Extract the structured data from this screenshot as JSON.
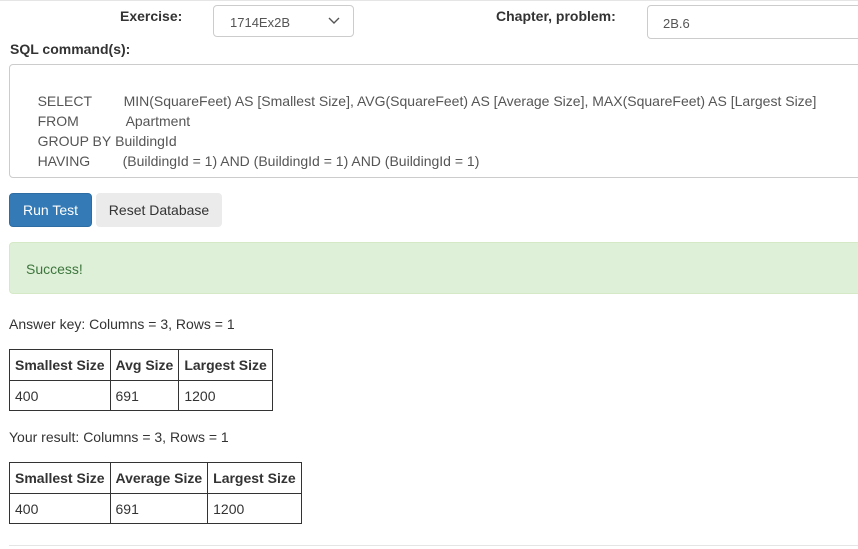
{
  "form": {
    "exercise_label": "Exercise:",
    "exercise_value": "1714Ex2B",
    "chapter_label": "Chapter, problem:",
    "chapter_value": "2B.6",
    "sql_label": "SQL command(s):"
  },
  "sql": {
    "lines": [
      {
        "keyword": "SELECT",
        "text": "MIN(SquareFeet) AS [Smallest Size], AVG(SquareFeet) AS [Average Size], MAX(SquareFeet) AS [Largest Size]"
      },
      {
        "keyword": "FROM",
        "text": "Apartment"
      },
      {
        "keyword": "GROUP BY",
        "text": "BuildingId"
      },
      {
        "keyword": "HAVING",
        "text": "(BuildingId = 1) AND (BuildingId = 1) AND (BuildingId = 1)"
      }
    ]
  },
  "buttons": {
    "run_test": "Run Test",
    "reset_database": "Reset Database"
  },
  "status": {
    "message": "Success!"
  },
  "answer_key": {
    "caption": "Answer key: Columns = 3, Rows = 1",
    "headers": [
      "Smallest Size",
      "Avg Size",
      "Largest Size"
    ],
    "rows": [
      [
        "400",
        "691",
        "1200"
      ]
    ]
  },
  "your_result": {
    "caption": "Your result: Columns = 3, Rows = 1",
    "headers": [
      "Smallest Size",
      "Average Size",
      "Largest Size"
    ],
    "rows": [
      [
        "400",
        "691",
        "1200"
      ]
    ]
  },
  "colors": {
    "primary": "#337ab7",
    "success_bg": "#dff0d8",
    "success_text": "#3c763d"
  }
}
